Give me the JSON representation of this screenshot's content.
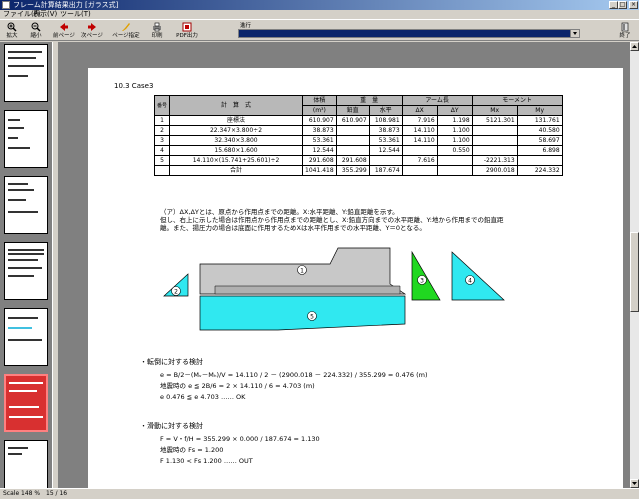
{
  "window": {
    "title": "フレーム計算結果出力 [ガラス式]",
    "min_glyph": "_",
    "max_glyph": "□",
    "close_glyph": "×"
  },
  "menu": [
    {
      "label": "ファイル(F)"
    },
    {
      "label": "表示(V)"
    },
    {
      "label": "ツール(T)"
    }
  ],
  "toolbar": {
    "buttons": [
      {
        "label": "拡大",
        "icon": "zoom-in-icon"
      },
      {
        "label": "縮小",
        "icon": "zoom-out-icon"
      },
      {
        "label": "前ページ",
        "icon": "prev-page-icon"
      },
      {
        "label": "次ページ",
        "icon": "next-page-icon"
      },
      {
        "label": "ページ指定",
        "icon": "page-jump-icon"
      },
      {
        "label": "印刷",
        "icon": "print-icon"
      },
      {
        "label": "PDF出力",
        "icon": "pdf-icon"
      }
    ],
    "progress_label": "進行",
    "exit_label": "終了"
  },
  "document": {
    "heading": "10.3 Case3",
    "table": {
      "headers": {
        "no": "番号",
        "formula": "計　算　式",
        "volume": "体積",
        "volume_unit": "(m³)",
        "weight": "重　量",
        "w_vertical": "鉛直",
        "w_horizontal": "水平",
        "w_unit": "(kN)",
        "arm": "アーム長",
        "dx": "ΔX",
        "dy": "ΔY",
        "arm_unit": "(m)",
        "moment": "モーメント",
        "mx": "Mx",
        "my": "My",
        "m_unit": "(kN・m)"
      },
      "rows": [
        {
          "no": "1",
          "formula": "座標法",
          "vol": "610.907",
          "v": "610.907",
          "h": "108.981",
          "dx": "7.916",
          "dy": "1.198",
          "mx": "5121.301",
          "my": "131.761"
        },
        {
          "no": "2",
          "formula": "22.347×3.800÷2",
          "vol": "38.873",
          "v": "",
          "h": "38.873",
          "dx": "14.110",
          "dy": "1.100",
          "mx": "",
          "my": "40.580"
        },
        {
          "no": "3",
          "formula": "32.340×3.800",
          "vol": "53.361",
          "v": "",
          "h": "53.361",
          "dx": "14.110",
          "dy": "1.100",
          "mx": "",
          "my": "58.697"
        },
        {
          "no": "4",
          "formula": "15.680×1.600",
          "vol": "12.544",
          "v": "",
          "h": "12.544",
          "dx": "",
          "dy": "0.550",
          "mx": "",
          "my": "6.898"
        },
        {
          "no": "5",
          "formula": "14.110×(15.741+25.601)÷2",
          "vol": "291.608",
          "v": "291.608",
          "h": "",
          "dx": "7.616",
          "dy": "",
          "mx": "-2221.313",
          "my": ""
        },
        {
          "no": "",
          "formula": "合計",
          "vol": "1041.418",
          "v": "355.299",
          "h": "187.674",
          "dx": "",
          "dy": "",
          "mx": "2900.018",
          "my": "224.332"
        }
      ]
    },
    "note1": "（ア）ΔX,ΔYとは、原点から作用点までの距離。X:水平距離、Y:鉛直距離を示す。",
    "note2": "但し、右上に示した場合は作用点から作用点までの距離とし、X:鉛直方向までの水平距離、Y:地から作用までの鉛直距",
    "note3": "離。また、揚圧力の場合は底面に作用するためXは水平作用までの水平距離、Y＝0となる。",
    "labels": [
      "1",
      "2",
      "3",
      "4",
      "5"
    ],
    "section1_title": "・転倒に対する検討",
    "s1_line1": "e = B/2－(Mᵥ－Mₕ)/V = 14.110 / 2 － (2900.018 － 224.332) / 355.299 = 0.476 (m)",
    "s1_line2": "地震時の e ≦ 2B/6 = 2 × 14.110 / 6 = 4.703 (m)",
    "s1_line3": "e 0.476 ≦ e 4.703 …… OK",
    "section2_title": "・滑動に対する検討",
    "s2_line1": "F = V・f/H = 355.299 × 0.000 / 187.674 = 1.130",
    "s2_line2": "地震時の Fs = 1.200",
    "s2_line3": "F 1.130 < Fs 1.200 …… OUT"
  },
  "status": {
    "scale": "Scale 148 %",
    "page": "15 / 16"
  },
  "colors": {
    "shape_gray": "#c8c8c8",
    "shape_cyan": "#30e8f0",
    "shape_green": "#20d820",
    "table_header": "#b8b8b8",
    "selected_thumb": "#d83030"
  }
}
